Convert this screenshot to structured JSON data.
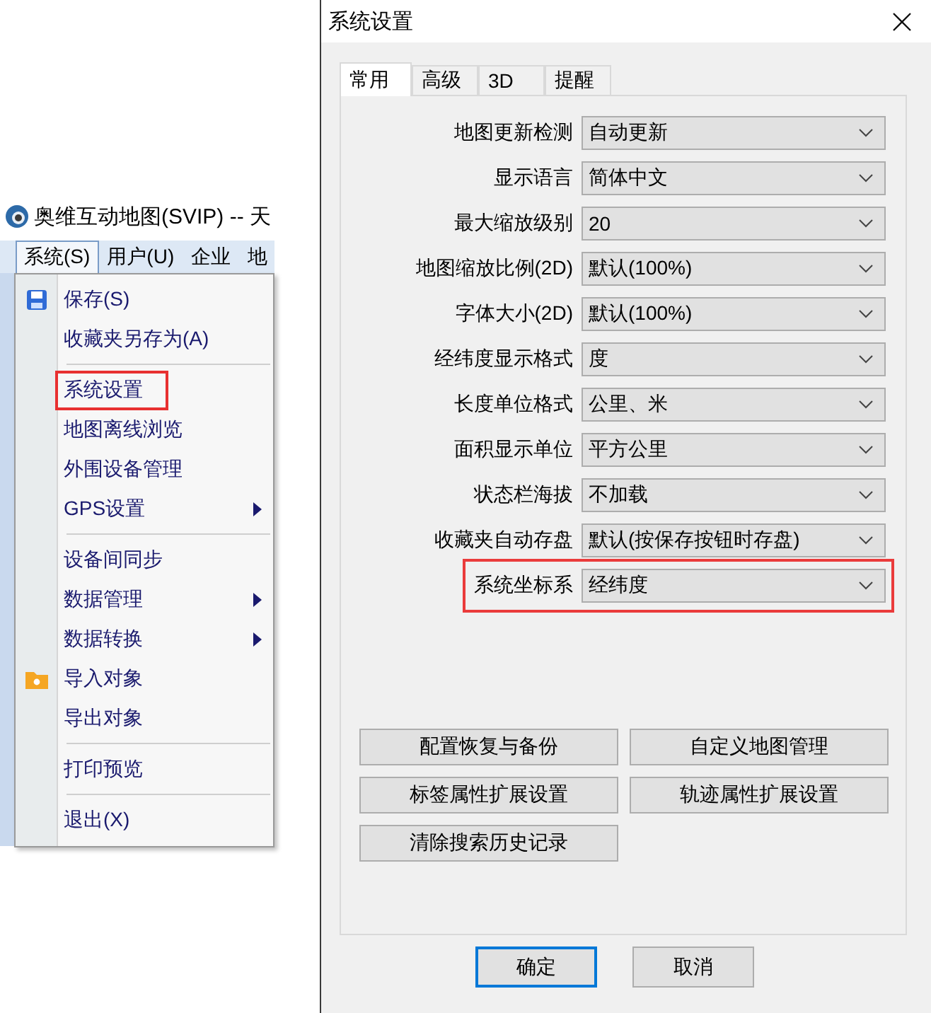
{
  "app": {
    "title": "奥维互动地图(SVIP) -- 天",
    "menubar": [
      {
        "label": "系统(S)",
        "selected": true
      },
      {
        "label": "用户(U)",
        "selected": false
      },
      {
        "label": "企业",
        "selected": false
      },
      {
        "label": "地",
        "selected": false
      }
    ],
    "menu": [
      {
        "kind": "disk-item",
        "label": "保存(S)",
        "submenu": false,
        "marked": false
      },
      {
        "kind": "item",
        "label": "收藏夹另存为(A)",
        "submenu": false,
        "marked": false
      },
      {
        "kind": "separator"
      },
      {
        "kind": "item",
        "label": "系统设置",
        "submenu": false,
        "marked": true
      },
      {
        "kind": "item",
        "label": "地图离线浏览",
        "submenu": false,
        "marked": false
      },
      {
        "kind": "item",
        "label": "外围设备管理",
        "submenu": false,
        "marked": false
      },
      {
        "kind": "item",
        "label": "GPS设置",
        "submenu": true,
        "marked": false
      },
      {
        "kind": "separator"
      },
      {
        "kind": "item",
        "label": "设备间同步",
        "submenu": false,
        "marked": false
      },
      {
        "kind": "item",
        "label": "数据管理",
        "submenu": true,
        "marked": false
      },
      {
        "kind": "item",
        "label": "数据转换",
        "submenu": true,
        "marked": false
      },
      {
        "kind": "folder-item",
        "label": "导入对象",
        "submenu": false,
        "marked": false
      },
      {
        "kind": "item",
        "label": "导出对象",
        "submenu": false,
        "marked": false
      },
      {
        "kind": "separator"
      },
      {
        "kind": "item",
        "label": "打印预览",
        "submenu": false,
        "marked": false
      },
      {
        "kind": "separator"
      },
      {
        "kind": "item",
        "label": "退出(X)",
        "submenu": false,
        "marked": false
      }
    ]
  },
  "dialog": {
    "title": "系统设置",
    "tabs": [
      {
        "label": "常用",
        "selected": true
      },
      {
        "label": "高级",
        "selected": false
      },
      {
        "label": "3D",
        "selected": false
      },
      {
        "label": "提醒",
        "selected": false
      }
    ],
    "settings": [
      {
        "label": "地图更新检测",
        "value": "自动更新",
        "marked": false
      },
      {
        "label": "显示语言",
        "value": "简体中文",
        "marked": false
      },
      {
        "label": "最大缩放级别",
        "value": "20",
        "marked": false
      },
      {
        "label": "地图缩放比例(2D)",
        "value": "默认(100%)",
        "marked": false
      },
      {
        "label": "字体大小(2D)",
        "value": "默认(100%)",
        "marked": false
      },
      {
        "label": "经纬度显示格式",
        "value": "度",
        "marked": false
      },
      {
        "label": "长度单位格式",
        "value": "公里、米",
        "marked": false
      },
      {
        "label": "面积显示单位",
        "value": "平方公里",
        "marked": false
      },
      {
        "label": "状态栏海拔",
        "value": "不加载",
        "marked": false
      },
      {
        "label": "收藏夹自动存盘",
        "value": "默认(按保存按钮时存盘)",
        "marked": false
      },
      {
        "label": "系统坐标系",
        "value": "经纬度",
        "marked": true
      }
    ],
    "actions": [
      "配置恢复与备份",
      "自定义地图管理",
      "标签属性扩展设置",
      "轨迹属性扩展设置",
      "清除搜索历史记录"
    ],
    "footer": [
      {
        "label": "确定",
        "default": true
      },
      {
        "label": "取消",
        "default": false
      }
    ]
  }
}
